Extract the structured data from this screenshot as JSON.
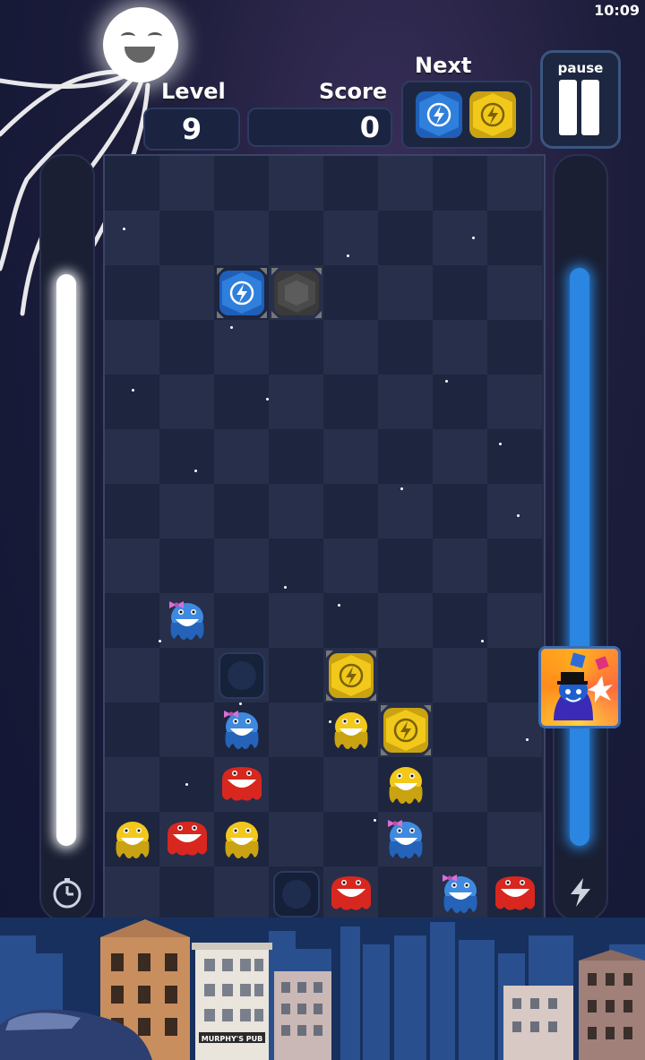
{
  "status_bar": {
    "time": "10:09"
  },
  "hud": {
    "level_label": "Level",
    "level_value": "9",
    "score_label": "Score",
    "score_value": "0",
    "next_label": "Next",
    "next_pieces": [
      "blue-bolt-block",
      "yellow-bolt-block"
    ],
    "pause_label": "pause"
  },
  "meters": {
    "left": {
      "icon": "stopwatch-icon",
      "level": 0.85,
      "color": "#ffffff"
    },
    "right": {
      "icon": "lightning-icon",
      "level": 0.86,
      "color": "#2a86e0"
    }
  },
  "board": {
    "cols": 8,
    "rows": 14,
    "falling_piece": [
      {
        "col": 2,
        "row": 2,
        "type": "blue-bolt-block"
      },
      {
        "col": 3,
        "row": 2,
        "type": "gray-block"
      }
    ],
    "pieces": [
      {
        "col": 1,
        "row": 8,
        "type": "blue-octo"
      },
      {
        "col": 2,
        "row": 9,
        "type": "ghost-slot"
      },
      {
        "col": 4,
        "row": 9,
        "type": "yellow-bolt-block"
      },
      {
        "col": 2,
        "row": 10,
        "type": "blue-octo"
      },
      {
        "col": 4,
        "row": 10,
        "type": "yellow-octo"
      },
      {
        "col": 5,
        "row": 10,
        "type": "yellow-bolt-block"
      },
      {
        "col": 2,
        "row": 11,
        "type": "red-blob"
      },
      {
        "col": 5,
        "row": 11,
        "type": "yellow-octo"
      },
      {
        "col": 0,
        "row": 12,
        "type": "yellow-octo"
      },
      {
        "col": 1,
        "row": 12,
        "type": "red-blob"
      },
      {
        "col": 2,
        "row": 12,
        "type": "yellow-octo"
      },
      {
        "col": 5,
        "row": 12,
        "type": "blue-octo"
      },
      {
        "col": 3,
        "row": 13,
        "type": "ghost-slot"
      },
      {
        "col": 4,
        "row": 13,
        "type": "red-blob"
      },
      {
        "col": 6,
        "row": 13,
        "type": "blue-octo"
      },
      {
        "col": 7,
        "row": 13,
        "type": "red-blob"
      }
    ]
  },
  "special_power": {
    "icon": "magician-powerup-icon"
  },
  "scenery": {
    "pub_sign": "MURPHY'S PUB"
  },
  "colors": {
    "blue": "#2f7fdc",
    "yellow": "#f2c81a",
    "red": "#d8271f",
    "gray": "#4a4a4a"
  }
}
